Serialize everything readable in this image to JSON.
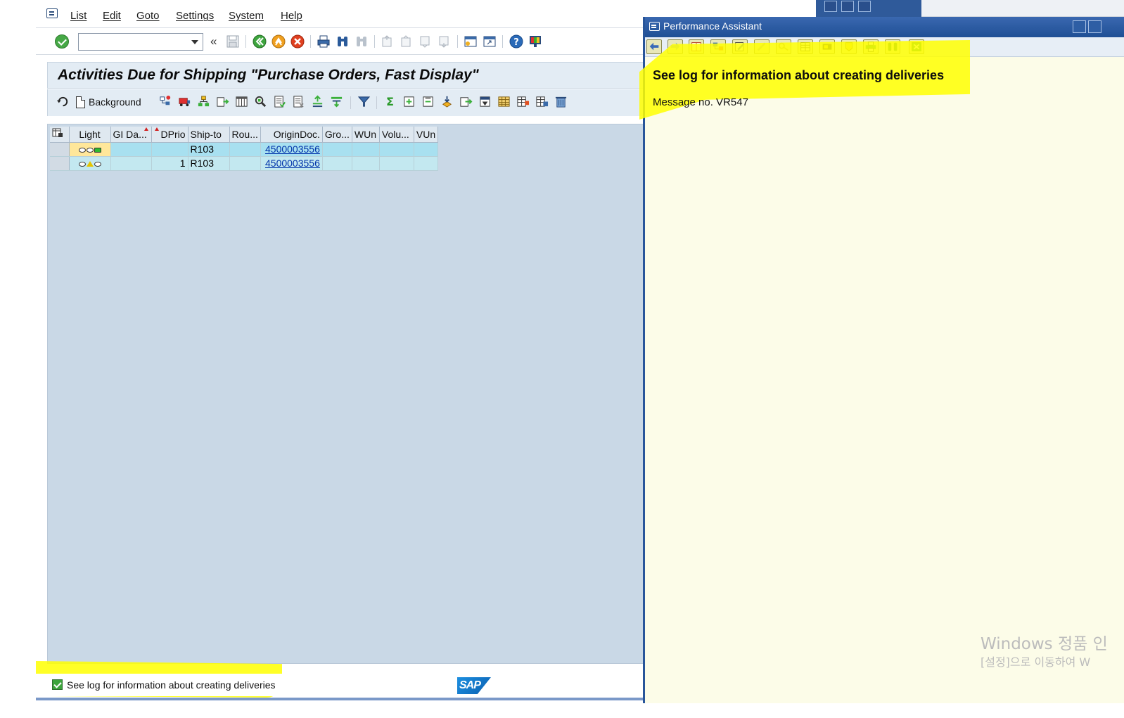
{
  "menu": {
    "items": [
      "List",
      "Edit",
      "Goto",
      "Settings",
      "System",
      "Help"
    ]
  },
  "toolbar": {
    "command_value": "",
    "collapse_glyph": "«"
  },
  "screen": {
    "title": "Activities Due for Shipping \"Purchase Orders, Fast Display\""
  },
  "app_toolbar": {
    "background_label": "Background"
  },
  "grid": {
    "columns": [
      "Light",
      "GI Da...",
      "DPrio",
      "Ship-to",
      "Rou...",
      "OriginDoc.",
      "Gro...",
      "WUn",
      "Volu...",
      "VUn"
    ],
    "rows": [
      {
        "light": "green",
        "gi_date": "",
        "dprio": "",
        "ship_to": "R103",
        "route": "",
        "origin_doc": "4500003556",
        "gross": "",
        "wun": "",
        "volume": "",
        "vun": ""
      },
      {
        "light": "yellow",
        "gi_date": "",
        "dprio": "1",
        "ship_to": "R103",
        "route": "",
        "origin_doc": "4500003556",
        "gross": "",
        "wun": "",
        "volume": "",
        "vun": ""
      }
    ]
  },
  "status": {
    "message": "See log for information about creating deliveries",
    "type": "success"
  },
  "performance_assistant": {
    "title": "Performance Assistant",
    "heading": "See log for information about creating deliveries",
    "message": "Message no. VR547"
  },
  "watermark": {
    "line1": "Windows 정품 인",
    "line2": "[설정]으로 이동하여 W"
  },
  "colors": {
    "highlight": "#ffff00",
    "title_band": "#e3ecf4",
    "grid_background": "#c9d8e6",
    "row_highlight": "#a8e0f0",
    "pa_titlebar": "#2a5aa0",
    "pa_background": "#fcfce8"
  }
}
